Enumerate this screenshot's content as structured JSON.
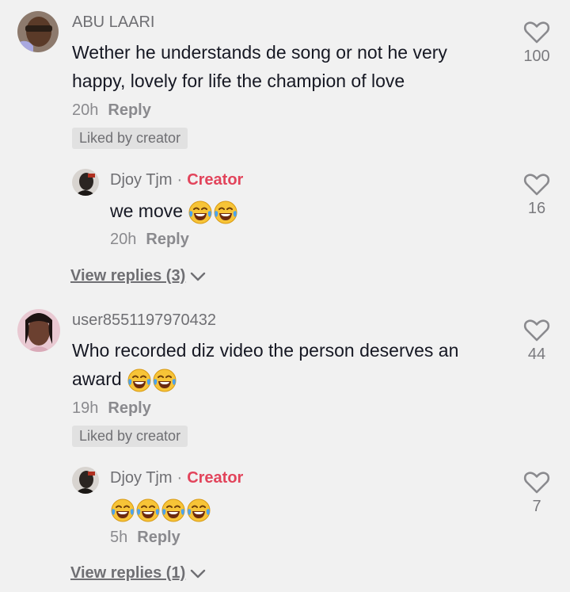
{
  "comments": [
    {
      "username": "ABU LAARI",
      "text": "Wether he understands de song or not he very happy, lovely for life the champion of love",
      "time": "20h",
      "reply_label": "Reply",
      "liked_badge": "Liked by creator",
      "likes": "100",
      "reply": {
        "username": "Djoy Tjm",
        "creator_label": "Creator",
        "separator": "·",
        "text": "we move",
        "time": "20h",
        "reply_label": "Reply",
        "likes": "16"
      },
      "view_replies": "View replies (3)"
    },
    {
      "username": "user8551197970432",
      "text": "Who recorded diz video the person deserves an award",
      "time": "19h",
      "reply_label": "Reply",
      "liked_badge": "Liked by creator",
      "likes": "44",
      "reply": {
        "username": "Djoy Tjm",
        "creator_label": "Creator",
        "separator": "·",
        "text": "",
        "time": "5h",
        "reply_label": "Reply",
        "likes": "7"
      },
      "view_replies": "View replies (1)"
    }
  ],
  "icons": {
    "like": "heart-outline-icon",
    "expand": "chevron-down-icon",
    "emoji": "face-with-tears-of-joy"
  },
  "colors": {
    "background": "#f1f1f1",
    "creator": "#e2445b",
    "badge_bg": "#e1e1e1"
  }
}
